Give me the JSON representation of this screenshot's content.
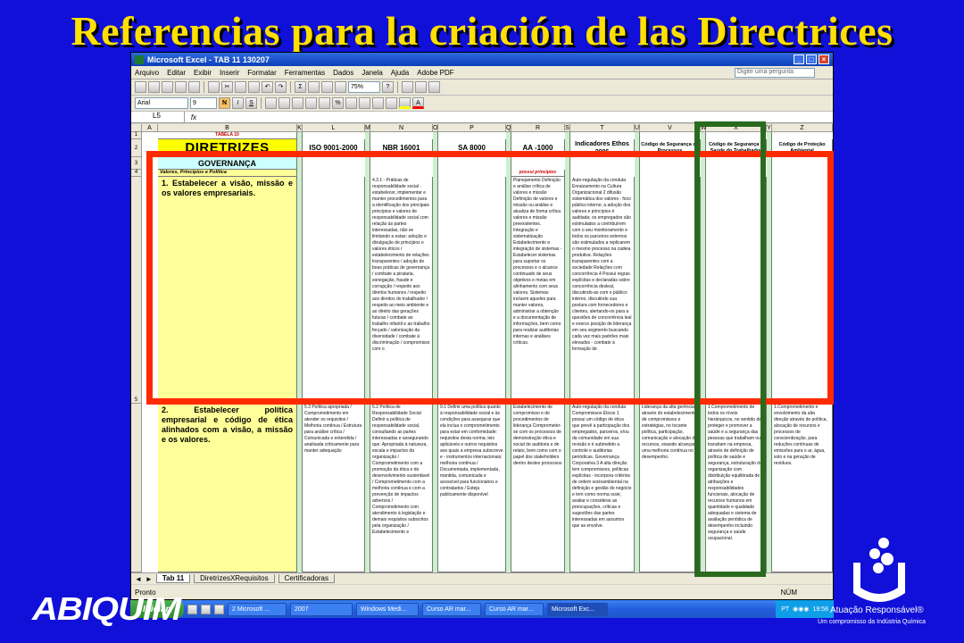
{
  "slide": {
    "title": "Referencias para la criación de las Directrices",
    "logo_left": "ABIQUIM",
    "logo_right_text": "Atuação Responsável®",
    "logo_right_sub": "Um compromisso da Indústria Química"
  },
  "window": {
    "title": "Microsoft Excel - TAB 11 130207",
    "menu": [
      "Arquivo",
      "Editar",
      "Exibir",
      "Inserir",
      "Formatar",
      "Ferramentas",
      "Dados",
      "Janela",
      "Ajuda",
      "Adobe PDF"
    ],
    "ask_placeholder": "Digite uma pergunta",
    "zoom": "75%",
    "font_name": "Arial",
    "font_size": "9",
    "name_box": "L5",
    "fx": "fx"
  },
  "columns": [
    "A",
    "B",
    "K",
    "L",
    "M",
    "N",
    "O",
    "P",
    "Q",
    "R",
    "S",
    "T",
    "U",
    "V",
    "W",
    "X",
    "Y",
    "Z"
  ],
  "rows": [
    "1",
    "2",
    "3",
    "4",
    "5"
  ],
  "sheet": {
    "tabela": "TABELA 10",
    "diretrizes": "DIRETRIZES",
    "headers": [
      "ISO 9001-2000",
      "NBR 16001",
      "SA 8000",
      "AA -1000",
      "Indicadores Ethos 2006",
      "Código de Segurança de Processos",
      "Código de Segurança e Saúde do Trabalhador",
      "Código de Proteção Ambiental"
    ],
    "governanca": "GOVERNANÇA",
    "valores": "Valores, Princípios e Política",
    "possui": "possui princípios",
    "d1": "1. Estabelecer a visão, missão e os valores empresariais.",
    "d2": "2. Estabelecer política empresarial e código de ética alinhados com a visão, a missão e os valores.",
    "r5_iso": "4.3.1 - Práticas de responsabilidade social - estabelecer, implementar e manter procedimentos para a identificação dos principais princípios e valores de responsabilidade social com relação às partes interessadas, não se limitando a estas: adoção e divulgação de princípios e valores éticos / estabelecimento de relações transparentes / adoção de boas práticas de governança / combate a pirataria, sonegação, fraude e corrupção / respeito aos direitos humanos / respeito aos direitos do trabalhador / respeito ao meio ambiente e ao direito das gerações futuras / combate ao trabalho infantil e ao trabalho forçado / valorização da diversidade / combate à discriminação / compromisso com o",
    "r5_aa": "Planejamento Definição e análise crítica de valores e missão Definição de valores e missão ou análise e atualiza de forma crítica valores e missão preexistentes. Integração e sistematização Estabelecimento e integração de sistemas - Estabelecer sistemas para suportar os processos e o alcance continuado de seus objetivos e metas em alinhamento com seus valores. Sistemas incluem aqueles para manter valores, administrar a obtenção e a documentação de informações, bem como para realizar auditorias internas e análises críticas.",
    "r5_ethos": "Auto-regulação da conduta Enraizamento na Cultura Organizacional 2 difusão sistemática dos valores - foco público interno; a adoção dos valores e princípios é auditada; os empregados são estimulados a contribuírem com o seu monitoramento e todos os parceiros externos são estimulados a replicarem o mesmo processo na cadeia produtiva. Relações transparentes com a sociedade Relações com concorrência 4 Possui regras explícitas e declaradas sobre concorrência desleal, discutindo-as com o público interno, discutindo sua postura com fornecedores e clientes, alertando-os para a questões de concorrência leal e exerce posição de liderança em seu segmento buscando cada vez mais padrões mais elevados - combate à formação de",
    "r6_l": "5.3 Política apropriada / Comprometimento em atender os requisitos / Melhoria contínua / Estrutura para análise crítica / Comunicada e entendida / analisada criticamente para manter adequação",
    "r6_n": "5.2 Política de Responsabilidade Social Definir a política de responsabilidade social, consultando as partes interessadas e assegurando que: Apropriada à natureza, escala e impactos da organização / Comprometimento com a promoção da ética e do desenvolvimento sustentável / Comprometimento com a melhoria contínua e com a prevenção de impactos adversos / Comprometimento com atendimento à legislação e demais requisitos subscritos pela organização / Estabelecimento e",
    "r6_p": "9.1 Definir uma política quanto à responsabilidade social e às condições para assegurar que ela inclua o comprometimento para estar em conformidade: requisitos desta norma; leis aplicáveis e outros requisitos aos quais a empresa subscreve e - instrumentos internacionais; melhoria contínua / Documentada, implementada, mantida, comunicada e acessível para funcionários e contratados / Esteja publicamente disponível",
    "r6_r": "Estabelecimento de compromisso e de procedimentos de liderança Comprometer-se com os processos de demonstração ética e social de auditoria e de relato, bem como com o papel dos stakeholders dentro destes processos",
    "r6_t": "Auto-regulação da conduta Compromissos Éticos 1 possui um código de ética que prevê a participação dos empregados, parceiros, e/ou da comunidade em sua revisão e é submetido a controle e auditorias periódicas. Governança Corporativa 3 A alta direção tem compromissos, políticas explícitas - incorpora critérios de ordem socioambiental na definição e gestão do negócio e tem como norma ouvir, avaliar e considerar as preocupações, críticas e sugestões das partes interessadas em assuntos que as envolve.",
    "r6_v": "Liderança da alta gerência através do estabelecimento de compromissos e estratégias, no tocante política, participação, comunicação e alocação de recursos, visando alcançar uma melhoria contínua no desempenho.",
    "r6_x": "1.Comprometimento de todos os níveis hierárquicos, no sentido de proteger e promover a saúde e a segurança das pessoas que trabalham ou transitam na empresa, através de definição de política de saúde e segurança, estruturação da organização com distribuição equilibrada de atribuições e responsabilidades funcionais, alocação de recursos humanos em quantidade e qualidade adequadas e sistema de avaliação periódica de desempenho incluindo segurança e saúde ocupacional.",
    "r6_z": "1.Comprometimento e envolvimento da alta direção através de política, alocação de recursos e processos de conscientização, para reduções contínuas de emissões para o ar, água, solo e na geração de resíduos."
  },
  "sheet_tabs": [
    "Tab 11",
    "DiretrizesXRequisitos",
    "Certificadoras"
  ],
  "status": {
    "left": "Pronto",
    "right": "NÚM"
  },
  "taskbar": {
    "start": "Iniciar",
    "tasks": [
      "2 Microsoft ...",
      "2007",
      "Windows Medi...",
      "Curso AR mar...",
      "Curso AR mar...",
      "Microsoft Exc..."
    ],
    "lang": "PT",
    "clock": "19:58"
  },
  "colors": {
    "background": "#1010d8",
    "title": "#ffe000",
    "red_box": "#ff2a00",
    "green_box": "#2a6a1e",
    "yellow_cell": "#ffff99"
  }
}
